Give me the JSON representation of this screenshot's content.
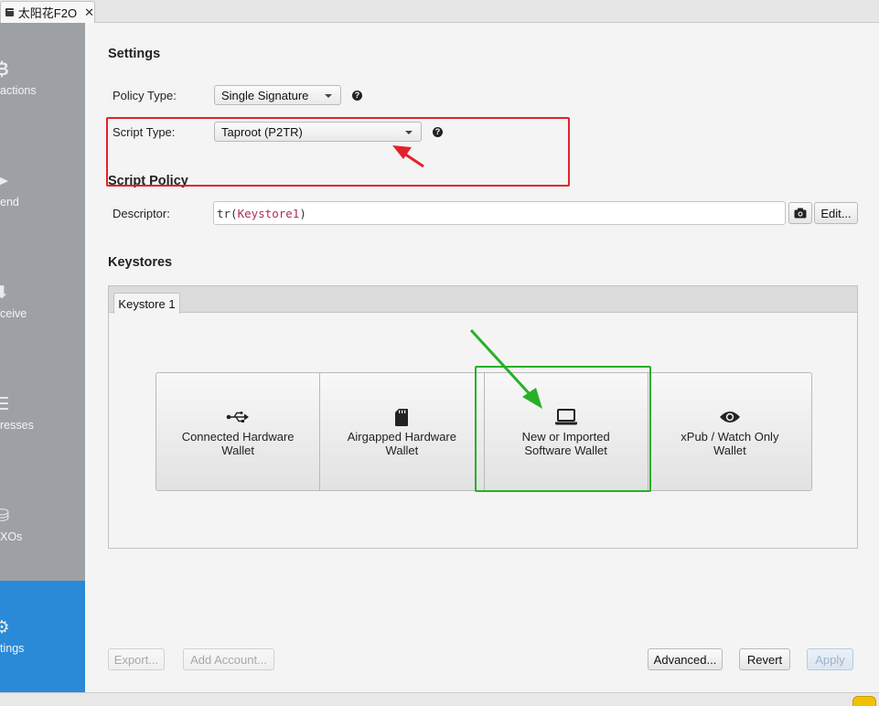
{
  "window": {
    "tab_title": "太阳花F2O",
    "tab_close": "✕"
  },
  "sidebar": {
    "items": [
      {
        "label": "actions",
        "icon": "bitcoin-icon",
        "glyph": "₿"
      },
      {
        "label": "end",
        "icon": "send-icon",
        "glyph": "➤"
      },
      {
        "label": "ceive",
        "icon": "receive-icon",
        "glyph": "⬇"
      },
      {
        "label": "resses",
        "icon": "addresses-icon",
        "glyph": "☰"
      },
      {
        "label": "XOs",
        "icon": "utxos-icon",
        "glyph": "⛁"
      },
      {
        "label": "tings",
        "icon": "gear-icon",
        "glyph": "⚙"
      }
    ],
    "active_index": 5
  },
  "settings": {
    "heading": "Settings",
    "policy_type_label": "Policy Type:",
    "policy_type_value": "Single Signature",
    "script_type_label": "Script Type:",
    "script_type_value": "Taproot (P2TR)",
    "help_glyph": "?"
  },
  "script_policy": {
    "heading": "Script Policy",
    "descriptor_label": "Descriptor:",
    "descriptor_prefix": "tr(",
    "descriptor_keystore": "Keystore1",
    "descriptor_suffix": ")",
    "edit_label": "Edit..."
  },
  "keystores": {
    "heading": "Keystores",
    "tab_label": "Keystore 1",
    "options": [
      {
        "line1": "Connected Hardware",
        "line2": "Wallet",
        "icon": "usb-icon"
      },
      {
        "line1": "Airgapped Hardware",
        "line2": "Wallet",
        "icon": "sd-card-icon"
      },
      {
        "line1": "New or Imported",
        "line2": "Software Wallet",
        "icon": "laptop-icon"
      },
      {
        "line1": "xPub / Watch Only",
        "line2": "Wallet",
        "icon": "eye-icon"
      }
    ]
  },
  "footer": {
    "export_label": "Export...",
    "add_account_label": "Add Account...",
    "advanced_label": "Advanced...",
    "revert_label": "Revert",
    "apply_label": "Apply"
  },
  "colors": {
    "sidebar_bg": "#9da1a6",
    "sidebar_active": "#2a8ad8",
    "annotation_red": "#e2222a",
    "annotation_green": "#27b027",
    "keystore_text": "#b02b55"
  }
}
